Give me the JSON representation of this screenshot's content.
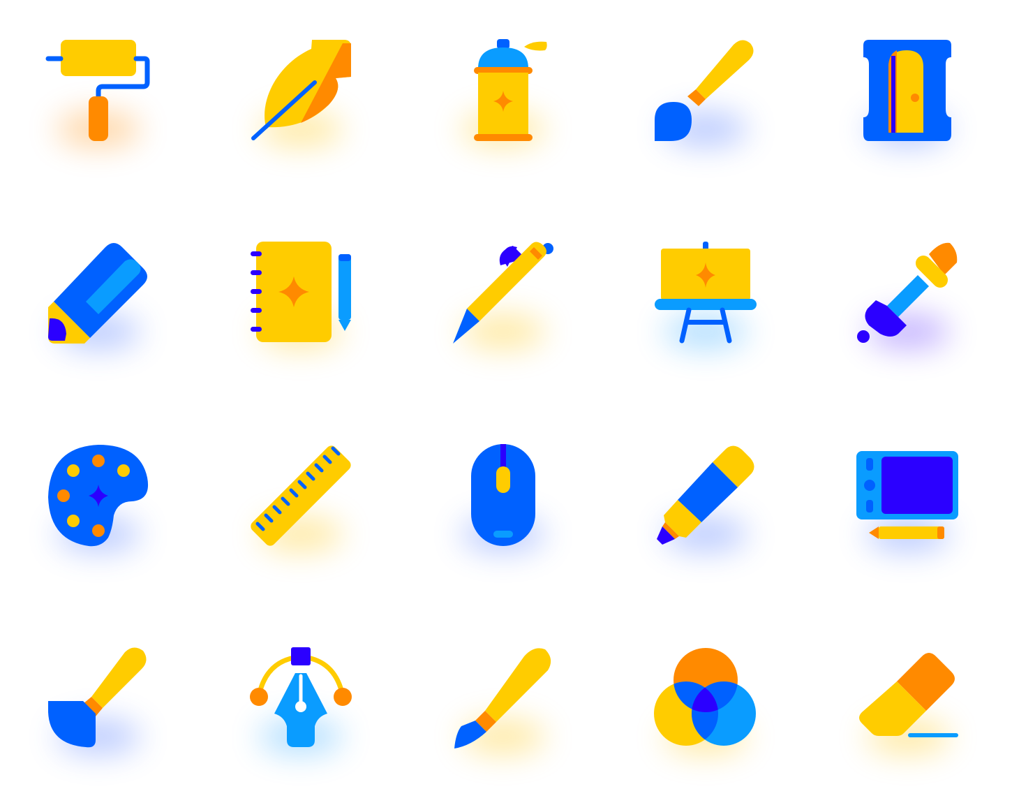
{
  "palette": {
    "yellow": "#FFCC00",
    "orange": "#FF8A00",
    "blue": "#0061FF",
    "sky": "#0A9CFF",
    "violet": "#2B00FF",
    "background": "#FFFFFF"
  },
  "icons": [
    {
      "name": "paint-roller-icon"
    },
    {
      "name": "feather-quill-icon"
    },
    {
      "name": "spray-paint-can-icon"
    },
    {
      "name": "paint-brush-icon"
    },
    {
      "name": "pencil-sharpener-icon"
    },
    {
      "name": "pencil-icon"
    },
    {
      "name": "sketchbook-icon"
    },
    {
      "name": "pen-icon"
    },
    {
      "name": "easel-icon"
    },
    {
      "name": "eyedropper-icon"
    },
    {
      "name": "color-palette-icon"
    },
    {
      "name": "ruler-icon"
    },
    {
      "name": "computer-mouse-icon"
    },
    {
      "name": "highlighter-marker-icon"
    },
    {
      "name": "graphics-tablet-icon"
    },
    {
      "name": "wide-brush-icon"
    },
    {
      "name": "bezier-pen-tool-icon"
    },
    {
      "name": "fountain-pen-icon"
    },
    {
      "name": "color-circles-icon"
    },
    {
      "name": "eraser-icon"
    }
  ]
}
